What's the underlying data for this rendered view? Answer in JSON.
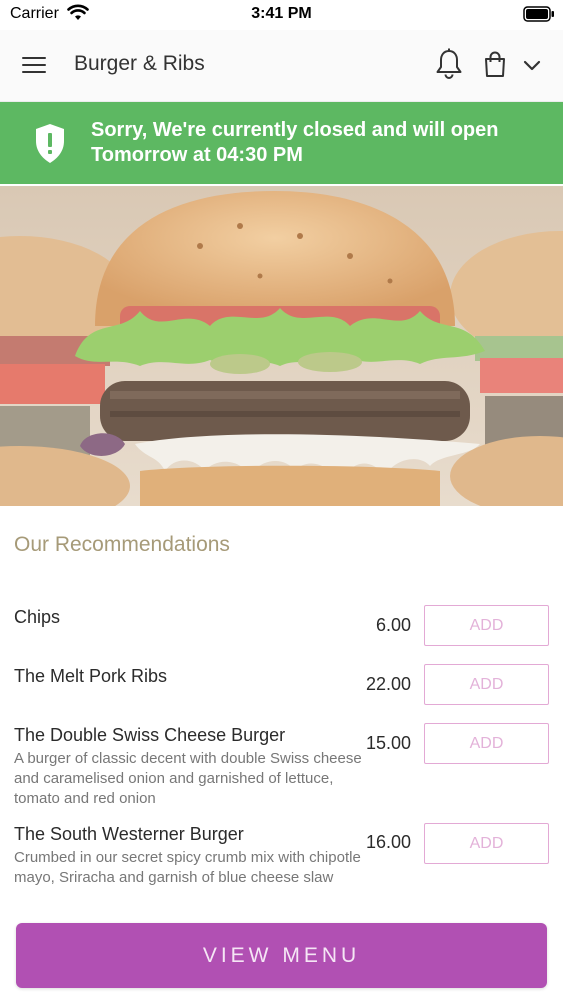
{
  "status_bar": {
    "carrier": "Carrier",
    "time": "3:41 PM"
  },
  "nav": {
    "title": "Burger & Ribs",
    "icons": [
      "hamburger-menu-icon",
      "bell-icon",
      "shopping-bag-icon",
      "chevron-down-icon"
    ]
  },
  "banner": {
    "message": "Sorry, We're currently closed and will open Tomorrow at 04:30 PM",
    "icon": "shield-alert-icon",
    "color": "#5db862"
  },
  "recommendations": {
    "title": "Our Recommendations",
    "add_label": "ADD",
    "items": [
      {
        "name": "Chips",
        "price": "6.00",
        "description": ""
      },
      {
        "name": "The Melt Pork Ribs",
        "price": "22.00",
        "description": ""
      },
      {
        "name": "The Double Swiss Cheese Burger",
        "price": "15.00",
        "description": "A burger of classic decent with double Swiss cheese and caramelised onion and garnished of lettuce, tomato and red onion"
      },
      {
        "name": "The South Westerner Burger",
        "price": "16.00",
        "description": "Crumbed in our secret spicy crumb mix with chipotle mayo, Sriracha and garnish of blue cheese slaw"
      }
    ]
  },
  "footer": {
    "view_menu_label": "VIEW MENU",
    "accent": "#b150b3"
  }
}
